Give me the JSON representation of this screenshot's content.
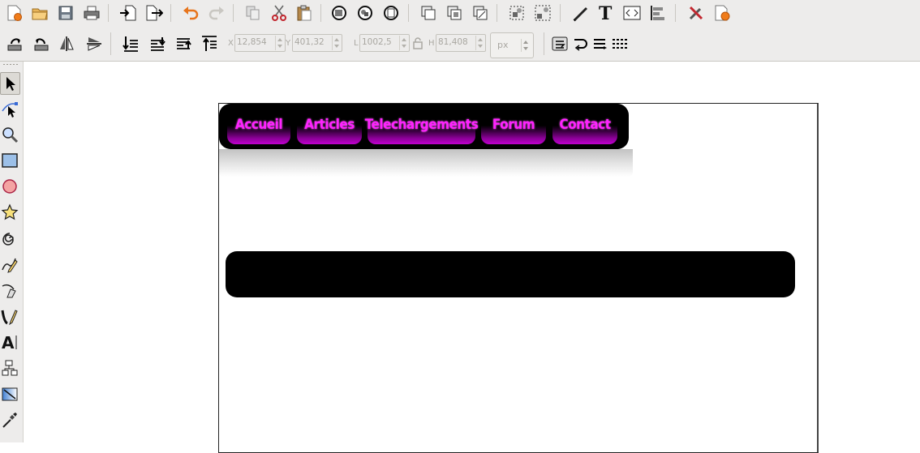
{
  "toolbar_top": {
    "buttons": [
      {
        "name": "new-document-icon"
      },
      {
        "name": "open-folder-icon"
      },
      {
        "name": "save-icon"
      },
      {
        "name": "print-icon"
      },
      {
        "name": "import-icon"
      },
      {
        "name": "export-icon"
      },
      {
        "name": "undo-icon"
      },
      {
        "name": "redo-icon"
      },
      {
        "name": "copy-icon"
      },
      {
        "name": "cut-icon"
      },
      {
        "name": "paste-icon"
      },
      {
        "name": "zoom-selection-icon"
      },
      {
        "name": "zoom-drawing-icon"
      },
      {
        "name": "zoom-page-icon"
      },
      {
        "name": "duplicate-icon"
      },
      {
        "name": "clone-icon"
      },
      {
        "name": "unlink-clone-icon"
      },
      {
        "name": "group-icon"
      },
      {
        "name": "ungroup-icon"
      },
      {
        "name": "fill-stroke-icon"
      },
      {
        "name": "text-font-icon"
      },
      {
        "name": "xml-editor-icon"
      },
      {
        "name": "align-distribute-icon"
      },
      {
        "name": "preferences-icon"
      },
      {
        "name": "document-properties-icon"
      }
    ]
  },
  "toolbar_controls": {
    "x_label": "X",
    "x_value": "12,854",
    "y_label": "Y",
    "y_value": "401,32",
    "w_label": "L",
    "w_value": "1002,5",
    "h_label": "H",
    "h_value": "81,408",
    "unit": "px"
  },
  "tools": [
    {
      "name": "selector-tool-icon",
      "active": true
    },
    {
      "name": "node-tool-icon"
    },
    {
      "name": "zoom-tool-icon"
    },
    {
      "name": "rectangle-tool-icon"
    },
    {
      "name": "ellipse-tool-icon"
    },
    {
      "name": "star-tool-icon"
    },
    {
      "name": "spiral-tool-icon"
    },
    {
      "name": "pencil-tool-icon"
    },
    {
      "name": "pen-tool-icon"
    },
    {
      "name": "calligraphy-tool-icon"
    },
    {
      "name": "text-tool-icon"
    },
    {
      "name": "connector-tool-icon"
    },
    {
      "name": "gradient-tool-icon"
    },
    {
      "name": "dropper-tool-icon"
    }
  ],
  "canvas": {
    "menu_items": [
      "Accueil",
      "Articles",
      "Telechargements",
      "Forum",
      "Contact"
    ],
    "menu_text_color": "#ff22ff"
  }
}
